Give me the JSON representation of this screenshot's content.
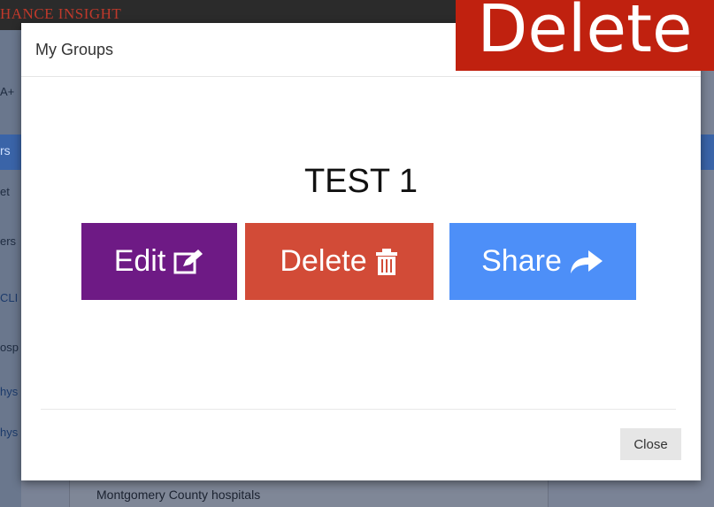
{
  "background": {
    "brand": "HANCE INSIGHT",
    "rows": [
      {
        "text": "A+",
        "style": ""
      },
      {
        "text": "et",
        "style": ""
      },
      {
        "text": "ers",
        "style": ""
      },
      {
        "text": "CLI",
        "style": "link"
      },
      {
        "text": "osp",
        "style": ""
      },
      {
        "text": "hys",
        "style": "link"
      },
      {
        "text": "hys",
        "style": "link"
      }
    ],
    "bluebar_text": "rs",
    "list_item": "Montgomery County hospitals"
  },
  "modal": {
    "title": "My Groups",
    "group_name": "TEST 1",
    "buttons": {
      "edit": {
        "label": "Edit",
        "icon": "edit-icon"
      },
      "delete": {
        "label": "Delete",
        "icon": "trash-icon"
      },
      "share": {
        "label": "Share",
        "icon": "share-arrow-icon"
      }
    },
    "close_label": "Close"
  },
  "overlay": {
    "label": "Delete",
    "color": "#c0210f"
  },
  "colors": {
    "edit": "#6e1a85",
    "delete": "#d24b37",
    "share": "#4d8ff8"
  }
}
